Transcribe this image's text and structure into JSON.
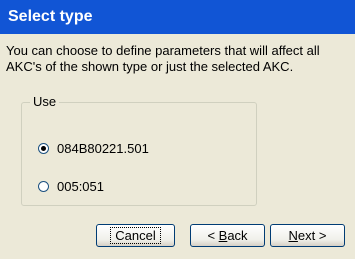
{
  "header": {
    "title": "Select type"
  },
  "description": "You can choose to define parameters that will affect all AKC's of the shown type or just the selected AKC.",
  "use_group": {
    "legend": "Use",
    "options": [
      {
        "label": "084B80221.501",
        "selected": true
      },
      {
        "label": "005:051",
        "selected": false
      }
    ]
  },
  "buttons": {
    "cancel": "Cancel",
    "back_prefix": "< ",
    "back_mnemonic": "B",
    "back_rest": "ack",
    "next_mnemonic": "N",
    "next_rest": "ext >"
  }
}
